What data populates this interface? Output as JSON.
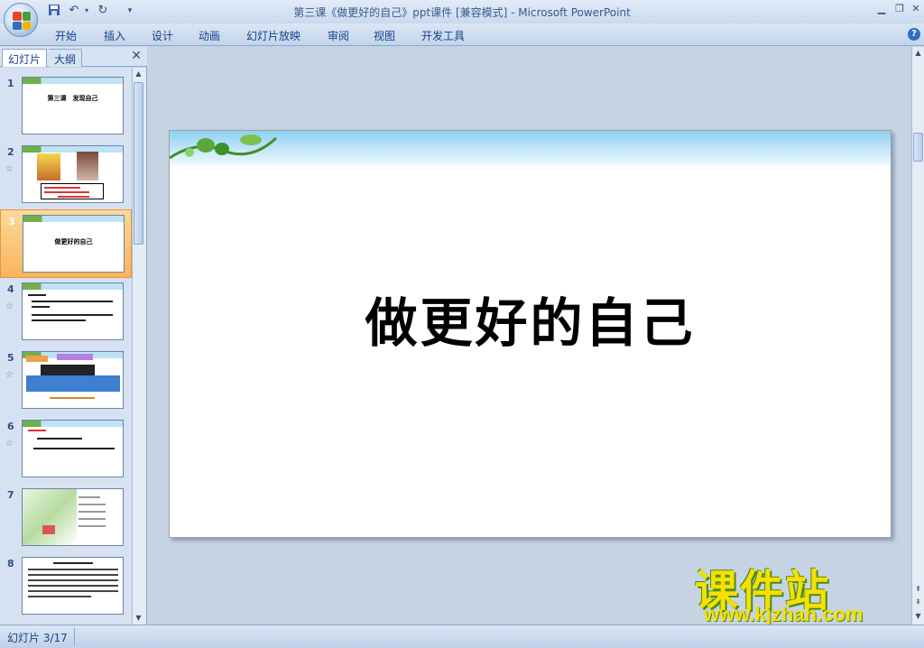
{
  "window": {
    "title": "第三课《做更好的自己》ppt课件 [兼容模式] - Microsoft PowerPoint"
  },
  "ribbon": {
    "tabs": [
      "开始",
      "插入",
      "设计",
      "动画",
      "幻灯片放映",
      "审阅",
      "视图",
      "开发工具"
    ]
  },
  "pane": {
    "tab_slides": "幻灯片",
    "tab_outline": "大纲",
    "thumbnails": [
      {
        "num": "1",
        "title": "第三课　发现自己"
      },
      {
        "num": "2",
        "title": ""
      },
      {
        "num": "3",
        "title": "做更好的自己"
      },
      {
        "num": "4",
        "title": ""
      },
      {
        "num": "5",
        "title": ""
      },
      {
        "num": "6",
        "title": ""
      },
      {
        "num": "7",
        "title": ""
      },
      {
        "num": "8",
        "title": ""
      }
    ]
  },
  "slide": {
    "title": "做更好的自己"
  },
  "watermark": {
    "text": "课件站",
    "url": "www.kjzhan.com"
  },
  "status": {
    "slide_indicator": "幻灯片 3/17"
  },
  "colors": {
    "accent": "#f9b55b",
    "ribbon": "#c4d4ea"
  }
}
